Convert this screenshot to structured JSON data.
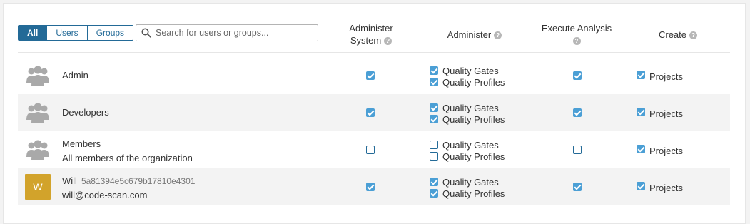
{
  "filter": {
    "buttons": [
      {
        "label": "All",
        "active": true
      },
      {
        "label": "Users",
        "active": false
      },
      {
        "label": "Groups",
        "active": false
      }
    ]
  },
  "search": {
    "placeholder": "Search for users or groups..."
  },
  "columns": {
    "administer_system_line1": "Administer",
    "administer_system_line2": "System",
    "administer": "Administer",
    "execute_analysis": "Execute Analysis",
    "create": "Create"
  },
  "help_glyph": "?",
  "rows": [
    {
      "type": "group",
      "icon": "group-icon",
      "name": "Admin",
      "description": "",
      "administer_system": true,
      "quality_gates_label": "Quality Gates",
      "quality_gates": true,
      "quality_profiles_label": "Quality Profiles",
      "quality_profiles": true,
      "execute_analysis": true,
      "projects_label": "Projects",
      "projects": true
    },
    {
      "type": "group",
      "icon": "group-icon",
      "name": "Developers",
      "description": "",
      "administer_system": true,
      "quality_gates_label": "Quality Gates",
      "quality_gates": true,
      "quality_profiles_label": "Quality Profiles",
      "quality_profiles": true,
      "execute_analysis": true,
      "projects_label": "Projects",
      "projects": true
    },
    {
      "type": "group",
      "icon": "group-icon",
      "name": "Members",
      "description": "All members of the organization",
      "administer_system": false,
      "quality_gates_label": "Quality Gates",
      "quality_gates": false,
      "quality_profiles_label": "Quality Profiles",
      "quality_profiles": false,
      "execute_analysis": false,
      "projects_label": "Projects",
      "projects": true
    },
    {
      "type": "user",
      "avatar_letter": "W",
      "avatar_color": "#d2a32b",
      "name": "Will",
      "login": "5a81394e5c679b17810e4301",
      "email": "will@code-scan.com",
      "administer_system": true,
      "quality_gates_label": "Quality Gates",
      "quality_gates": true,
      "quality_profiles_label": "Quality Profiles",
      "quality_profiles": true,
      "execute_analysis": true,
      "projects_label": "Projects",
      "projects": true
    }
  ],
  "colors": {
    "accent": "#236a97",
    "checkbox": "#4b9fd5",
    "row_alt": "#f3f3f3"
  }
}
